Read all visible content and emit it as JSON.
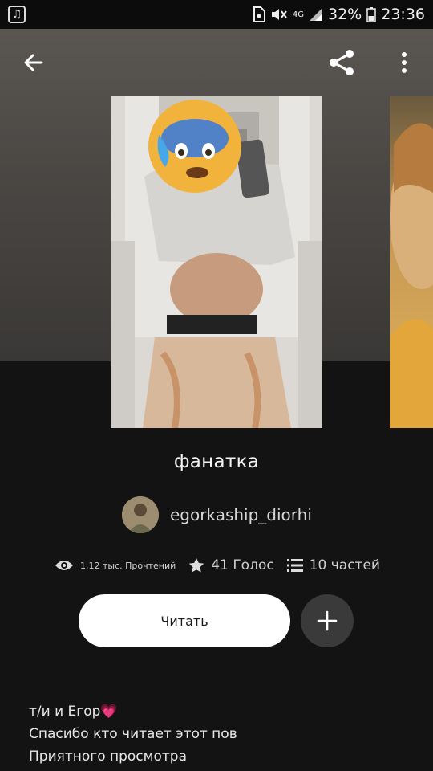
{
  "status_bar": {
    "battery": "32%",
    "time": "23:36",
    "network": "4G"
  },
  "book": {
    "title": "фанатка",
    "author": "egorkaship_diorhi",
    "reads": "1,12 тыс. Прочтений",
    "votes": "41 Голос",
    "parts": "10 частей"
  },
  "actions": {
    "read_label": "Читать",
    "add_label": "+"
  },
  "description": {
    "lines": [
      "т/и и Егор💗",
      "Спасибо кто читает этот пов",
      "Приятного просмотра"
    ]
  },
  "icons": {
    "back": "arrow-left-icon",
    "share": "share-icon",
    "more": "more-vertical-icon",
    "reads": "eye-icon",
    "votes": "star-icon",
    "parts": "list-icon"
  },
  "colors": {
    "background": "#121212",
    "button_primary": "#ffffff",
    "button_secondary": "#3a3a3a"
  }
}
